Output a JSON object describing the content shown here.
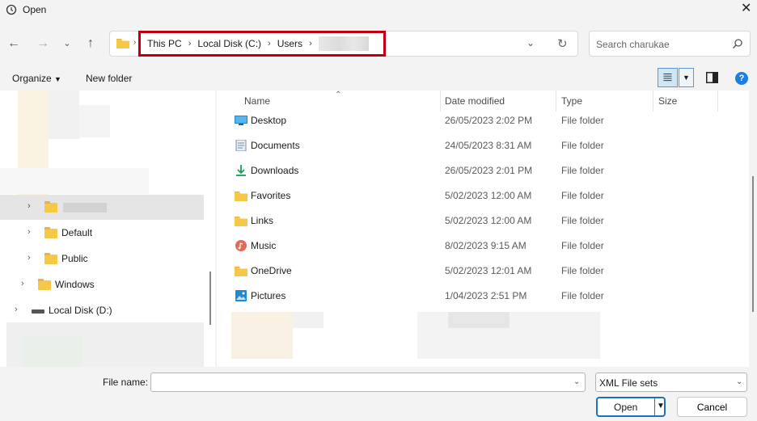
{
  "window": {
    "title": "Open"
  },
  "address": {
    "crumbs": [
      "This PC",
      "Local Disk (C:)",
      "Users"
    ],
    "highlight_color": "#c00012"
  },
  "search": {
    "placeholder": "Search charukae"
  },
  "toolbar": {
    "organize_label": "Organize",
    "new_folder_label": "New folder"
  },
  "tree": {
    "items": [
      {
        "label": "Default",
        "icon": "folder-icon"
      },
      {
        "label": "Public",
        "icon": "folder-icon"
      },
      {
        "label": "Windows",
        "icon": "folder-icon"
      },
      {
        "label": "Local Disk (D:)",
        "icon": "drive-icon"
      }
    ]
  },
  "columns": {
    "name": "Name",
    "date": "Date modified",
    "type": "Type",
    "size": "Size"
  },
  "files": [
    {
      "name": "Desktop",
      "date": "26/05/2023 2:02 PM",
      "type": "File folder",
      "icon": "desktop-folder-icon"
    },
    {
      "name": "Documents",
      "date": "24/05/2023 8:31 AM",
      "type": "File folder",
      "icon": "documents-folder-icon"
    },
    {
      "name": "Downloads",
      "date": "26/05/2023 2:01 PM",
      "type": "File folder",
      "icon": "downloads-folder-icon"
    },
    {
      "name": "Favorites",
      "date": "5/02/2023 12:00 AM",
      "type": "File folder",
      "icon": "folder-icon"
    },
    {
      "name": "Links",
      "date": "5/02/2023 12:00 AM",
      "type": "File folder",
      "icon": "folder-icon"
    },
    {
      "name": "Music",
      "date": "8/02/2023 9:15 AM",
      "type": "File folder",
      "icon": "music-folder-icon"
    },
    {
      "name": "OneDrive",
      "date": "5/02/2023 12:01 AM",
      "type": "File folder",
      "icon": "folder-icon"
    },
    {
      "name": "Pictures",
      "date": "1/04/2023 2:51 PM",
      "type": "File folder",
      "icon": "pictures-folder-icon"
    }
  ],
  "footer": {
    "file_name_label": "File name:",
    "file_name_value": "",
    "file_type": "XML File sets",
    "open_label": "Open",
    "cancel_label": "Cancel"
  }
}
